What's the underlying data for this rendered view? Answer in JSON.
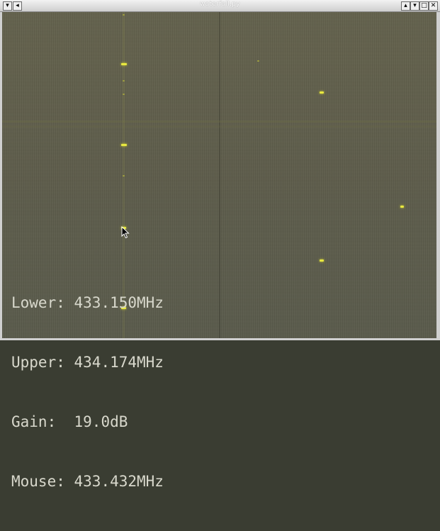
{
  "window": {
    "title": "waterfall.py",
    "buttons": {
      "menu": "▾",
      "left": "◂",
      "shade": "▴",
      "minimize": "▾",
      "maximize": "□",
      "close": "✕"
    }
  },
  "readout": {
    "lower_label": "Lower:",
    "lower_value": "433.150MHz",
    "upper_label": "Upper:",
    "upper_value": "434.174MHz",
    "gain_label": "Gain:",
    "gain_value": "19.0dB",
    "mouse_label": "Mouse:",
    "mouse_value": "433.432MHz"
  },
  "colors": {
    "background": "#5f5e4b",
    "signal": "#e8e840",
    "text": "#d8d8cc"
  },
  "icons": {
    "cursor": "arrow-cursor-icon"
  }
}
